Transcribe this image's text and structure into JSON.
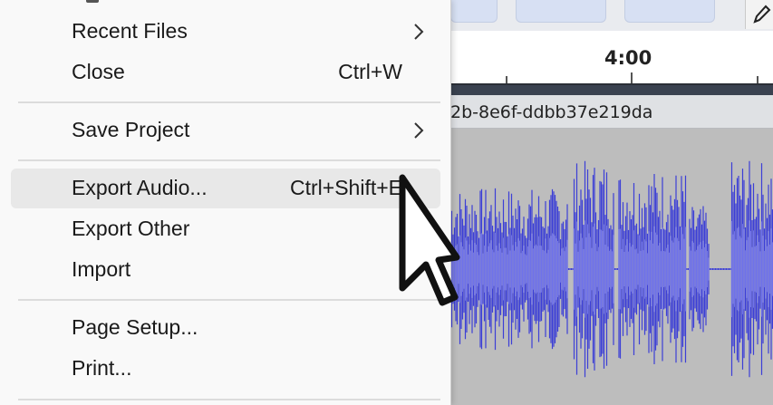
{
  "menu": {
    "items": [
      {
        "label": "Recent Files",
        "shortcut": "",
        "submenu": true
      },
      {
        "label": "Close",
        "shortcut": "Ctrl+W",
        "submenu": false
      },
      {
        "label": "Save Project",
        "shortcut": "",
        "submenu": true
      },
      {
        "label": "Export Audio...",
        "shortcut": "Ctrl+Shift+E",
        "submenu": false,
        "highlighted": true
      },
      {
        "label": "Export Other",
        "shortcut": "",
        "submenu": false
      },
      {
        "label": "Import",
        "shortcut": "",
        "submenu": false
      },
      {
        "label": "Page Setup...",
        "shortcut": "",
        "submenu": false
      },
      {
        "label": "Print...",
        "shortcut": "",
        "submenu": false
      }
    ]
  },
  "timeline": {
    "ruler_label": "4:00"
  },
  "track": {
    "name": "2b-8e6f-ddbb37e219da"
  },
  "colors": {
    "waveform": "#3c3fd6",
    "waveform_light": "#6f72ea",
    "waveform_bg": "#bdbdbd",
    "menu_bg": "#f9f9f9",
    "highlight": "#e8e8e8"
  },
  "icons": {
    "submenu": "chevron-right-icon",
    "toolbar": "pencil-icon",
    "pointer": "mouse-pointer-icon"
  }
}
